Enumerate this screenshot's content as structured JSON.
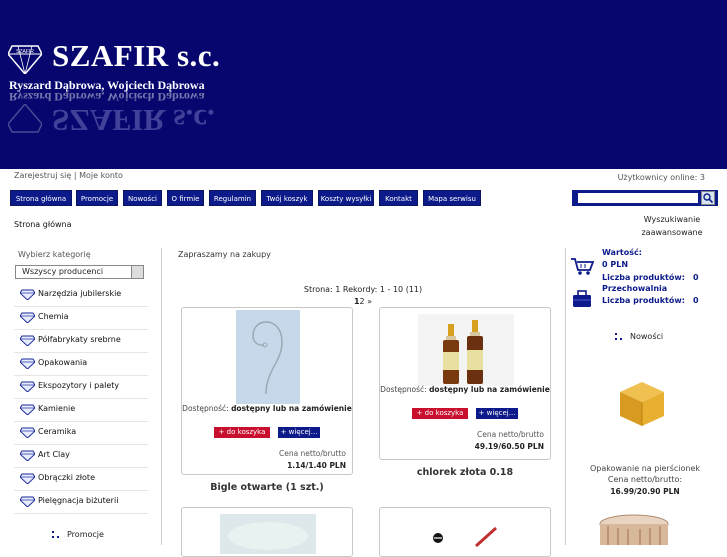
{
  "header": {
    "logo_title": "SZAFIR s.c.",
    "logo_subtitle": "Ryszard Dąbrowa, Wojciech Dąbrowa",
    "logo_diamond_text": "SZAFIR"
  },
  "toplinks": {
    "register": "Zarejestruj się",
    "separator": "|",
    "account": "Moje konto"
  },
  "users_online": "Użytkownicy online: 3",
  "nav": {
    "items": [
      "Strona główna",
      "Promocje",
      "Nowości",
      "O firmie",
      "Regulamin",
      "Twój koszyk",
      "Koszty wysyłki",
      "Kontakt",
      "Mapa serwisu"
    ]
  },
  "search": {
    "placeholder": "",
    "advanced": "Wyszukiwanie zaawansowane"
  },
  "breadcrumb": "Strona główna",
  "left": {
    "title": "Wybierz kategorię",
    "select_value": "Wszyscy producenci",
    "categories": [
      "Narzędzia jubilerskie",
      "Chemia",
      "Półfabrykaty srebrne",
      "Opakowania",
      "Ekspozytory i palety",
      "Kamienie",
      "Ceramika",
      "Art Clay",
      "Obrączki złote",
      "Pielęgnacja biżuterii"
    ],
    "promo_label": "Promocje"
  },
  "main": {
    "title": "Zapraszamy na zakupy",
    "pager_info": "Strona: 1 Rekordy: 1 - 10 (11)",
    "pager_current": "1",
    "pager_next": "2",
    "pager_arrow": "»",
    "products": [
      {
        "avail_label": "Dostępność:",
        "avail_value": "dostępny lub na zamówienie",
        "cart_label": "+ do koszyka",
        "more_label": "+ więcej...",
        "price_label": "Cena netto/brutto",
        "price": "1.14/1.40 PLN",
        "name": "Bigle otwarte (1 szt.)"
      },
      {
        "avail_label": "Dostępność:",
        "avail_value": "dostępny lub na zamówienie",
        "cart_label": "+ do koszyka",
        "more_label": "+ więcej...",
        "price_label": "Cena netto/brutto",
        "price": "49.19/60.50 PLN",
        "name": "chlorek złota 0.18"
      }
    ]
  },
  "right": {
    "value_label": "Wartość:",
    "value": "0 PLN",
    "count_label": "Liczba produktów:",
    "count": "0",
    "storage_label": "Przechowalnia",
    "storage_count_label": "Liczba produktów:",
    "storage_count": "0",
    "news_label": "Nowości",
    "news_product": "Opakowanie na pierścionek",
    "news_price_label": "Cena netto/brutto:",
    "news_price": "16.99/20.90 PLN"
  },
  "colors": {
    "header_bg": "#06066e",
    "nav_bg": "#0d1b8a",
    "cart_button": "#c8102e"
  }
}
